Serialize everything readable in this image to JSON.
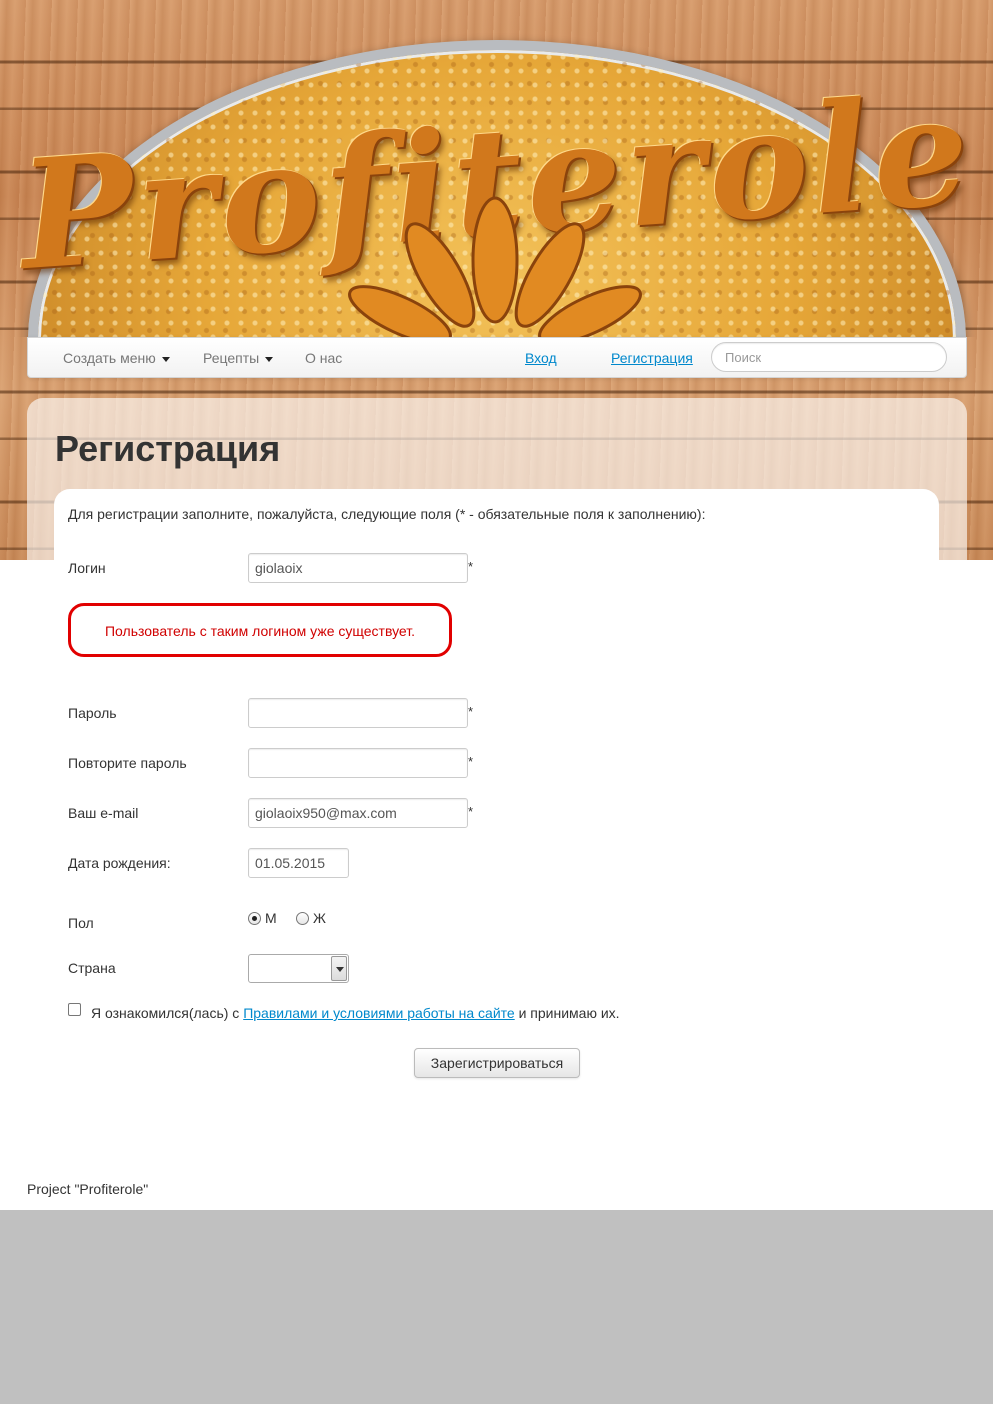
{
  "header": {
    "logo_text": "Profiterole"
  },
  "nav": {
    "create_menu": "Создать меню",
    "recipes": "Рецепты",
    "about": "О нас",
    "login": "Вход",
    "register": "Регистрация",
    "search_placeholder": "Поиск"
  },
  "page": {
    "title": "Регистрация",
    "intro": "Для регистрации заполните, пожалуйста, следующие поля (* - обязательные поля к заполнению):"
  },
  "form": {
    "required_mark": "*",
    "login": {
      "label": "Логин",
      "value": "giolaoix"
    },
    "login_error": "Пользователь с таким логином уже существует.",
    "password": {
      "label": "Пароль",
      "value": ""
    },
    "password_repeat": {
      "label": "Повторите пароль",
      "value": ""
    },
    "email": {
      "label": "Ваш e-mail",
      "value": "giolaoix950@max.com"
    },
    "birthdate": {
      "label": "Дата рождения:",
      "value": "01.05.2015"
    },
    "gender": {
      "label": "Пол",
      "options": [
        "М",
        "Ж"
      ],
      "selected": "М"
    },
    "country": {
      "label": "Страна",
      "value": ""
    },
    "agree": {
      "prefix": "Я ознакомился(лась) с ",
      "link": "Правилами и условиями работы на сайте",
      "suffix": " и принимаю их.",
      "checked": false
    },
    "submit_label": "Зарегистрироваться"
  },
  "footer": {
    "text": "Project \"Profiterole\""
  },
  "colors": {
    "link": "#0088cc",
    "error": "#e10000",
    "gray_bg": "#c0c0c0"
  }
}
